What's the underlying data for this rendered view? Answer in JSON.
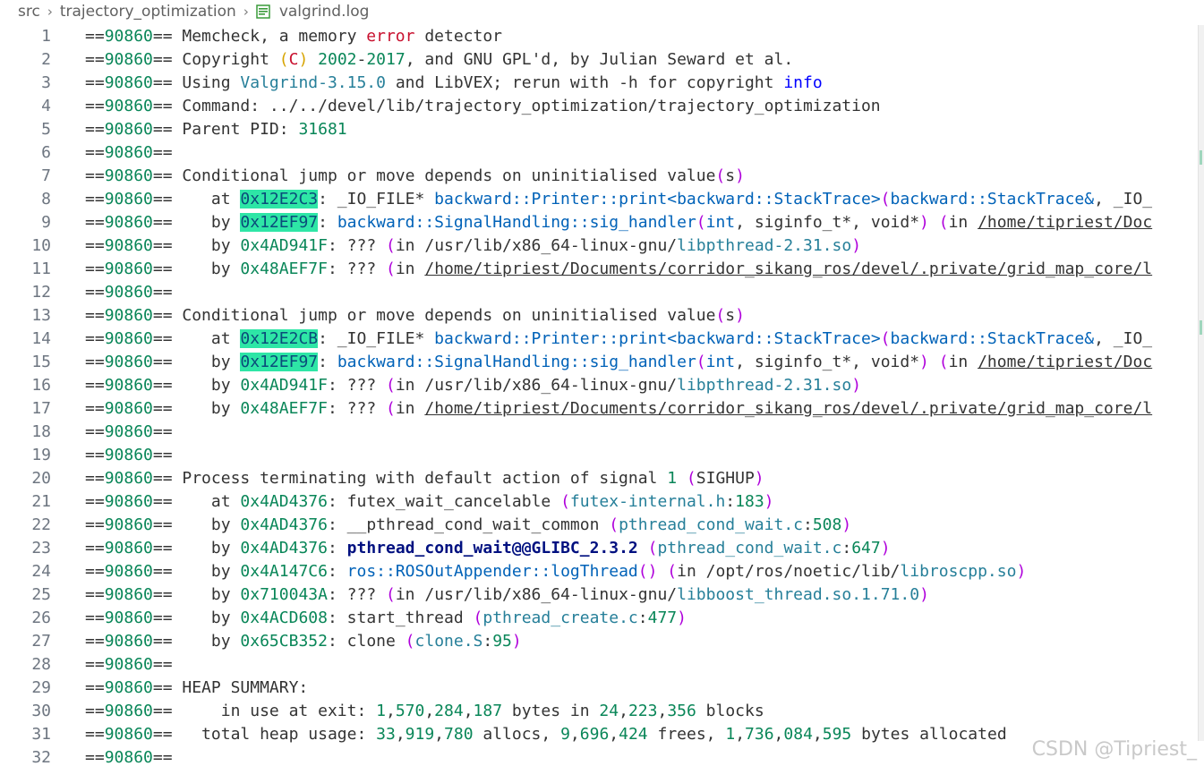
{
  "breadcrumb": {
    "items": [
      "src",
      "trajectory_optimization",
      "valgrind.log"
    ]
  },
  "icons": {
    "chevron": "chevron-right-icon",
    "file": "log-file-icon"
  },
  "colors": {
    "number": "#098658",
    "string_red": "#c8102e",
    "keyword_blue": "#0000ff",
    "function": "#0062b8",
    "file": "#267f99",
    "paren": "#af00db",
    "highlight": "#2ee6a6"
  },
  "lines": [
    {
      "n": "1",
      "s": [
        [
          "==",
          ""
        ],
        [
          "90860",
          "num"
        ],
        [
          "== Memcheck, a memory ",
          ""
        ],
        [
          "error",
          "red"
        ],
        [
          " detector",
          ""
        ]
      ]
    },
    {
      "n": "2",
      "s": [
        [
          "==",
          ""
        ],
        [
          "90860",
          "num"
        ],
        [
          "== Copyright ",
          ""
        ],
        [
          "(",
          "paren-y"
        ],
        [
          "C",
          "red"
        ],
        [
          ")",
          "paren-y"
        ],
        [
          " ",
          ""
        ],
        [
          "2002",
          "num"
        ],
        [
          "-",
          ""
        ],
        [
          "2017",
          "num"
        ],
        [
          ", and GNU GPL'd, by Julian Seward et al.",
          ""
        ]
      ]
    },
    {
      "n": "3",
      "s": [
        [
          "==",
          ""
        ],
        [
          "90860",
          "num"
        ],
        [
          "== Using ",
          ""
        ],
        [
          "Valgrind-3.15.0",
          "teal"
        ],
        [
          " and LibVEX; rerun with -h for copyright ",
          ""
        ],
        [
          "info",
          "blue"
        ]
      ]
    },
    {
      "n": "4",
      "s": [
        [
          "==",
          ""
        ],
        [
          "90860",
          "num"
        ],
        [
          "== Command: ../../devel/lib/trajectory_optimization/trajectory_optimization",
          ""
        ]
      ]
    },
    {
      "n": "5",
      "s": [
        [
          "==",
          ""
        ],
        [
          "90860",
          "num"
        ],
        [
          "== Parent PID: ",
          ""
        ],
        [
          "31681",
          "num"
        ]
      ]
    },
    {
      "n": "6",
      "s": [
        [
          "==",
          ""
        ],
        [
          "90860",
          "num"
        ],
        [
          "==",
          ""
        ]
      ]
    },
    {
      "n": "7",
      "s": [
        [
          "==",
          ""
        ],
        [
          "90860",
          "num"
        ],
        [
          "== Conditional jump or move depends on uninitialised value",
          ""
        ],
        [
          "(",
          "paren"
        ],
        [
          "s",
          ""
        ],
        [
          ")",
          "paren"
        ]
      ]
    },
    {
      "n": "8",
      "s": [
        [
          "==",
          ""
        ],
        [
          "90860",
          "num"
        ],
        [
          "==    at ",
          ""
        ],
        [
          "0x12E2C3",
          "hl"
        ],
        [
          ": _IO_FILE* ",
          ""
        ],
        [
          "backward::Printer::print<backward::StackTrace>",
          "fn"
        ],
        [
          "(",
          "paren"
        ],
        [
          "backward::StackTrace&",
          "fn"
        ],
        [
          ", _IO_",
          ""
        ]
      ]
    },
    {
      "n": "9",
      "s": [
        [
          "==",
          ""
        ],
        [
          "90860",
          "num"
        ],
        [
          "==    by ",
          ""
        ],
        [
          "0x12EF97",
          "hl"
        ],
        [
          ": ",
          ""
        ],
        [
          "backward::SignalHandling::sig_handler",
          "fn"
        ],
        [
          "(",
          "paren"
        ],
        [
          "int",
          "fn"
        ],
        [
          ", siginfo_t*, void*",
          ""
        ],
        [
          ")",
          "paren"
        ],
        [
          " ",
          ""
        ],
        [
          "(",
          "paren"
        ],
        [
          "in ",
          ""
        ],
        [
          "/home/tipriest/Doc",
          "ul"
        ]
      ]
    },
    {
      "n": "10",
      "s": [
        [
          "==",
          ""
        ],
        [
          "90860",
          "num"
        ],
        [
          "==    by ",
          ""
        ],
        [
          "0x4AD941F",
          "num"
        ],
        [
          ": ??? ",
          ""
        ],
        [
          "(",
          "paren"
        ],
        [
          "in /usr/lib/x86_64-linux-gnu/",
          ""
        ],
        [
          "libpthread-2.31.so",
          "teal"
        ],
        [
          ")",
          "paren"
        ]
      ]
    },
    {
      "n": "11",
      "s": [
        [
          "==",
          ""
        ],
        [
          "90860",
          "num"
        ],
        [
          "==    by ",
          ""
        ],
        [
          "0x48AEF7F",
          "num"
        ],
        [
          ": ??? ",
          ""
        ],
        [
          "(",
          "paren"
        ],
        [
          "in ",
          ""
        ],
        [
          "/home/tipriest/Documents/corridor_sikang_ros/devel/.private/grid_map_core/l",
          "ul"
        ]
      ]
    },
    {
      "n": "12",
      "s": [
        [
          "==",
          ""
        ],
        [
          "90860",
          "num"
        ],
        [
          "==",
          ""
        ]
      ]
    },
    {
      "n": "13",
      "s": [
        [
          "==",
          ""
        ],
        [
          "90860",
          "num"
        ],
        [
          "== Conditional jump or move depends on uninitialised value",
          ""
        ],
        [
          "(",
          "paren"
        ],
        [
          "s",
          ""
        ],
        [
          ")",
          "paren"
        ]
      ]
    },
    {
      "n": "14",
      "s": [
        [
          "==",
          ""
        ],
        [
          "90860",
          "num"
        ],
        [
          "==    at ",
          ""
        ],
        [
          "0x12E2CB",
          "hl"
        ],
        [
          ": _IO_FILE* ",
          ""
        ],
        [
          "backward::Printer::print<backward::StackTrace>",
          "fn"
        ],
        [
          "(",
          "paren"
        ],
        [
          "backward::StackTrace&",
          "fn"
        ],
        [
          ", _IO_",
          ""
        ]
      ]
    },
    {
      "n": "15",
      "s": [
        [
          "==",
          ""
        ],
        [
          "90860",
          "num"
        ],
        [
          "==    by ",
          ""
        ],
        [
          "0x12EF97",
          "hl"
        ],
        [
          ": ",
          ""
        ],
        [
          "backward::SignalHandling::sig_handler",
          "fn"
        ],
        [
          "(",
          "paren"
        ],
        [
          "int",
          "fn"
        ],
        [
          ", siginfo_t*, void*",
          ""
        ],
        [
          ")",
          "paren"
        ],
        [
          " ",
          ""
        ],
        [
          "(",
          "paren"
        ],
        [
          "in ",
          ""
        ],
        [
          "/home/tipriest/Doc",
          "ul"
        ]
      ]
    },
    {
      "n": "16",
      "s": [
        [
          "==",
          ""
        ],
        [
          "90860",
          "num"
        ],
        [
          "==    by ",
          ""
        ],
        [
          "0x4AD941F",
          "num"
        ],
        [
          ": ??? ",
          ""
        ],
        [
          "(",
          "paren"
        ],
        [
          "in /usr/lib/x86_64-linux-gnu/",
          ""
        ],
        [
          "libpthread-2.31.so",
          "teal"
        ],
        [
          ")",
          "paren"
        ]
      ]
    },
    {
      "n": "17",
      "s": [
        [
          "==",
          ""
        ],
        [
          "90860",
          "num"
        ],
        [
          "==    by ",
          ""
        ],
        [
          "0x48AEF7F",
          "num"
        ],
        [
          ": ??? ",
          ""
        ],
        [
          "(",
          "paren"
        ],
        [
          "in ",
          ""
        ],
        [
          "/home/tipriest/Documents/corridor_sikang_ros/devel/.private/grid_map_core/l",
          "ul"
        ]
      ]
    },
    {
      "n": "18",
      "s": [
        [
          "==",
          ""
        ],
        [
          "90860",
          "num"
        ],
        [
          "==",
          ""
        ]
      ]
    },
    {
      "n": "19",
      "s": [
        [
          "==",
          ""
        ],
        [
          "90860",
          "num"
        ],
        [
          "==",
          ""
        ]
      ]
    },
    {
      "n": "20",
      "s": [
        [
          "==",
          ""
        ],
        [
          "90860",
          "num"
        ],
        [
          "== Process terminating with default action of signal ",
          ""
        ],
        [
          "1",
          "num"
        ],
        [
          " ",
          ""
        ],
        [
          "(",
          "paren"
        ],
        [
          "SIGHUP",
          ""
        ],
        [
          ")",
          "paren"
        ]
      ]
    },
    {
      "n": "21",
      "s": [
        [
          "==",
          ""
        ],
        [
          "90860",
          "num"
        ],
        [
          "==    at ",
          ""
        ],
        [
          "0x4AD4376",
          "num"
        ],
        [
          ": futex_wait_cancelable ",
          ""
        ],
        [
          "(",
          "paren"
        ],
        [
          "futex-internal.h",
          "teal"
        ],
        [
          ":",
          ""
        ],
        [
          "183",
          "num"
        ],
        [
          ")",
          "paren"
        ]
      ]
    },
    {
      "n": "22",
      "s": [
        [
          "==",
          ""
        ],
        [
          "90860",
          "num"
        ],
        [
          "==    by ",
          ""
        ],
        [
          "0x4AD4376",
          "num"
        ],
        [
          ": __pthread_cond_wait_common ",
          ""
        ],
        [
          "(",
          "paren"
        ],
        [
          "pthread_cond_wait.c",
          "teal"
        ],
        [
          ":",
          ""
        ],
        [
          "508",
          "num"
        ],
        [
          ")",
          "paren"
        ]
      ]
    },
    {
      "n": "23",
      "s": [
        [
          "==",
          ""
        ],
        [
          "90860",
          "num"
        ],
        [
          "==    by ",
          ""
        ],
        [
          "0x4AD4376",
          "num"
        ],
        [
          ": ",
          ""
        ],
        [
          "pthread_cond_wait@@GLIBC_2.3.2",
          "bold"
        ],
        [
          " ",
          ""
        ],
        [
          "(",
          "paren"
        ],
        [
          "pthread_cond_wait.c",
          "teal"
        ],
        [
          ":",
          ""
        ],
        [
          "647",
          "num"
        ],
        [
          ")",
          "paren"
        ]
      ]
    },
    {
      "n": "24",
      "s": [
        [
          "==",
          ""
        ],
        [
          "90860",
          "num"
        ],
        [
          "==    by ",
          ""
        ],
        [
          "0x4A147C6",
          "num"
        ],
        [
          ": ",
          ""
        ],
        [
          "ros::ROSOutAppender::logThread",
          "fn"
        ],
        [
          "()",
          "paren"
        ],
        [
          " ",
          ""
        ],
        [
          "(",
          "paren"
        ],
        [
          "in /opt/ros/noetic/lib/",
          ""
        ],
        [
          "libroscpp.so",
          "teal"
        ],
        [
          ")",
          "paren"
        ]
      ]
    },
    {
      "n": "25",
      "s": [
        [
          "==",
          ""
        ],
        [
          "90860",
          "num"
        ],
        [
          "==    by ",
          ""
        ],
        [
          "0x710043A",
          "num"
        ],
        [
          ": ??? ",
          ""
        ],
        [
          "(",
          "paren"
        ],
        [
          "in /usr/lib/x86_64-linux-gnu/",
          ""
        ],
        [
          "libboost_thread.so.1.71.0",
          "teal"
        ],
        [
          ")",
          "paren"
        ]
      ]
    },
    {
      "n": "26",
      "s": [
        [
          "==",
          ""
        ],
        [
          "90860",
          "num"
        ],
        [
          "==    by ",
          ""
        ],
        [
          "0x4ACD608",
          "num"
        ],
        [
          ": start_thread ",
          ""
        ],
        [
          "(",
          "paren"
        ],
        [
          "pthread_create.c",
          "teal"
        ],
        [
          ":",
          ""
        ],
        [
          "477",
          "num"
        ],
        [
          ")",
          "paren"
        ]
      ]
    },
    {
      "n": "27",
      "s": [
        [
          "==",
          ""
        ],
        [
          "90860",
          "num"
        ],
        [
          "==    by ",
          ""
        ],
        [
          "0x65CB352",
          "num"
        ],
        [
          ": clone ",
          ""
        ],
        [
          "(",
          "paren"
        ],
        [
          "clone.S",
          "teal"
        ],
        [
          ":",
          ""
        ],
        [
          "95",
          "num"
        ],
        [
          ")",
          "paren"
        ]
      ]
    },
    {
      "n": "28",
      "s": [
        [
          "==",
          ""
        ],
        [
          "90860",
          "num"
        ],
        [
          "==",
          ""
        ]
      ]
    },
    {
      "n": "29",
      "s": [
        [
          "==",
          ""
        ],
        [
          "90860",
          "num"
        ],
        [
          "== HEAP SUMMARY:",
          ""
        ]
      ]
    },
    {
      "n": "30",
      "s": [
        [
          "==",
          ""
        ],
        [
          "90860",
          "num"
        ],
        [
          "==     in use at exit: ",
          ""
        ],
        [
          "1",
          "num"
        ],
        [
          ",",
          ""
        ],
        [
          "570",
          "num"
        ],
        [
          ",",
          ""
        ],
        [
          "284",
          "num"
        ],
        [
          ",",
          ""
        ],
        [
          "187",
          "num"
        ],
        [
          " bytes in ",
          ""
        ],
        [
          "24",
          "num"
        ],
        [
          ",",
          ""
        ],
        [
          "223",
          "num"
        ],
        [
          ",",
          ""
        ],
        [
          "356",
          "num"
        ],
        [
          " blocks",
          ""
        ]
      ]
    },
    {
      "n": "31",
      "s": [
        [
          "==",
          ""
        ],
        [
          "90860",
          "num"
        ],
        [
          "==   total heap usage: ",
          ""
        ],
        [
          "33",
          "num"
        ],
        [
          ",",
          ""
        ],
        [
          "919",
          "num"
        ],
        [
          ",",
          ""
        ],
        [
          "780",
          "num"
        ],
        [
          " allocs, ",
          ""
        ],
        [
          "9",
          "num"
        ],
        [
          ",",
          ""
        ],
        [
          "696",
          "num"
        ],
        [
          ",",
          ""
        ],
        [
          "424",
          "num"
        ],
        [
          " frees, ",
          ""
        ],
        [
          "1",
          "num"
        ],
        [
          ",",
          ""
        ],
        [
          "736",
          "num"
        ],
        [
          ",",
          ""
        ],
        [
          "084",
          "num"
        ],
        [
          ",",
          ""
        ],
        [
          "595",
          "num"
        ],
        [
          " bytes allocated",
          ""
        ]
      ]
    },
    {
      "n": "32",
      "s": [
        [
          "==",
          ""
        ],
        [
          "90860",
          "num"
        ],
        [
          "==",
          ""
        ]
      ]
    }
  ],
  "watermark": "CSDN @Tipriest_"
}
